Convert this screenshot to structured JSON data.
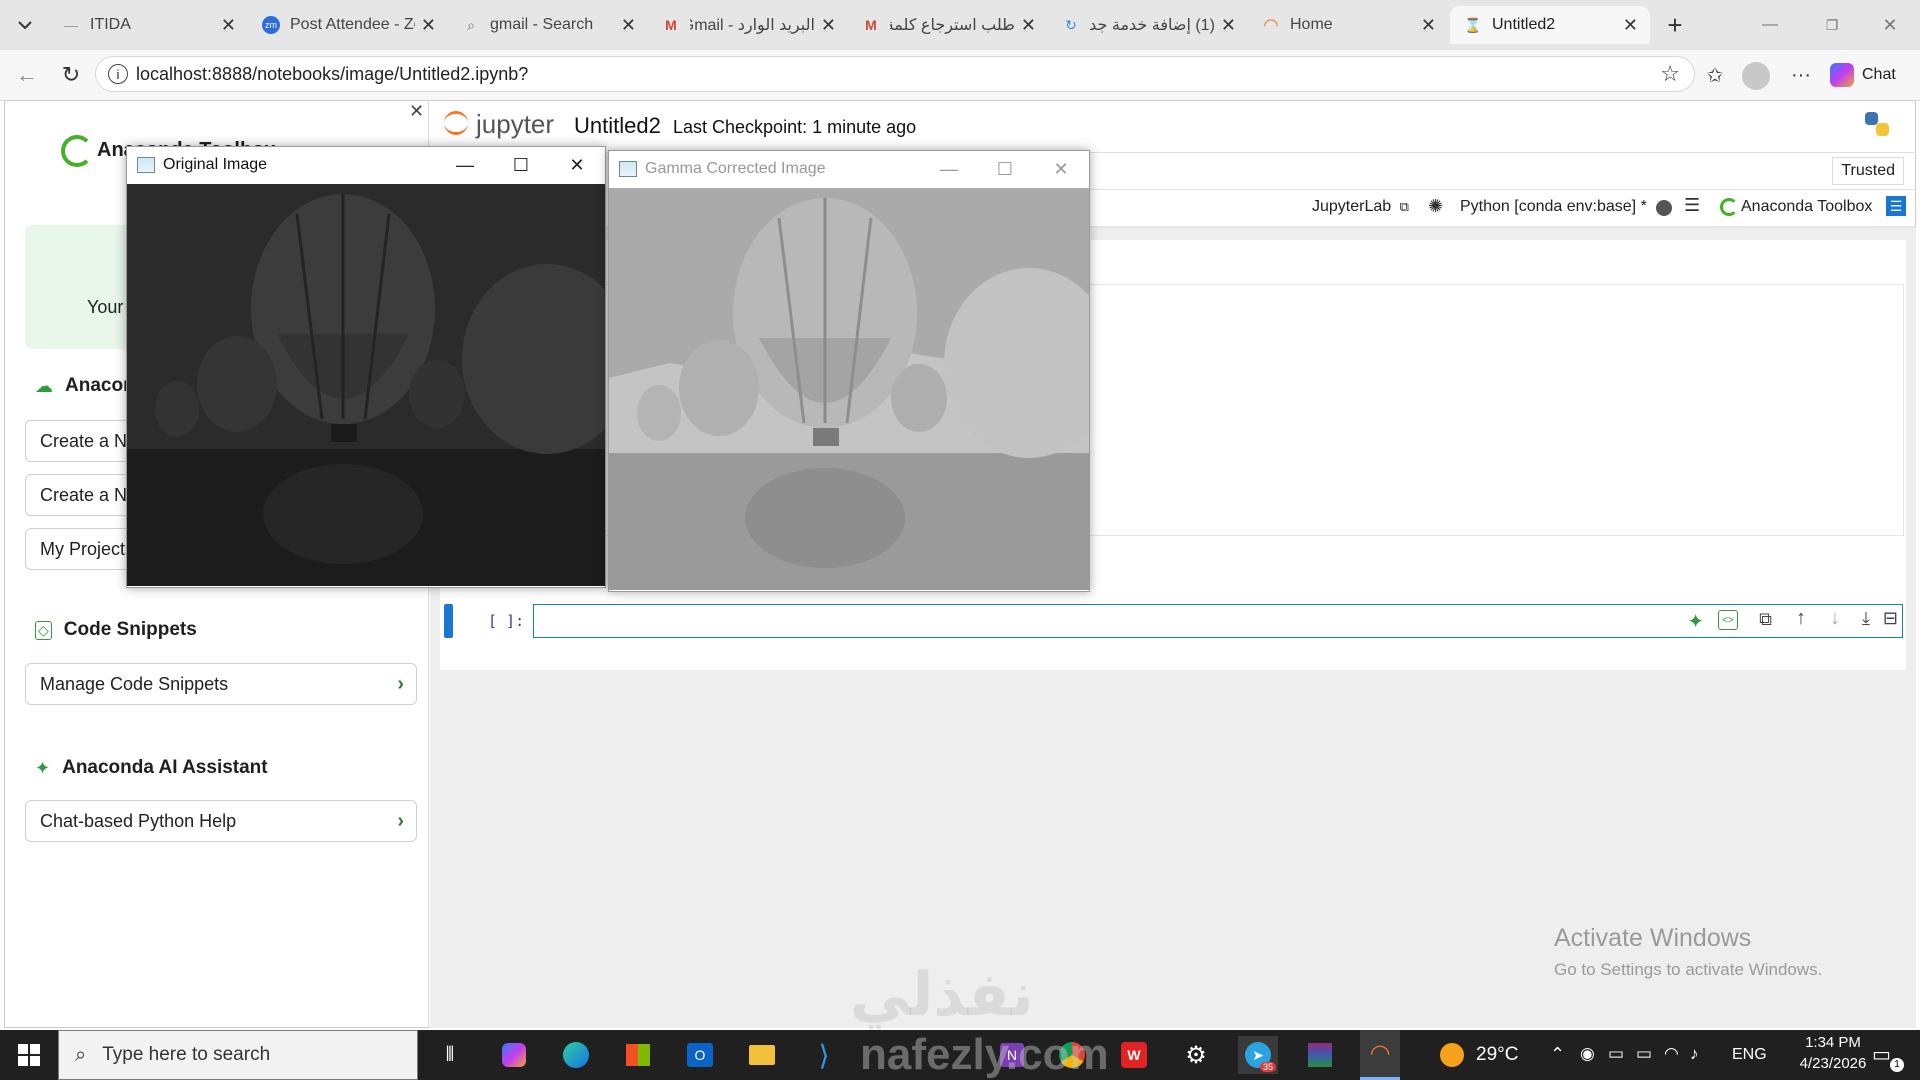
{
  "browser": {
    "tabs": [
      {
        "title": "ITIDA",
        "icon": "itida-icon"
      },
      {
        "title": "Post Attendee - Zo",
        "icon": "zoom-icon"
      },
      {
        "title": "gmail - Search",
        "icon": "search-icon"
      },
      {
        "title": "البريد الوارد - Gmail",
        "icon": "gmail-icon"
      },
      {
        "title": "طلب استرجاع كلمة",
        "icon": "gmail-icon"
      },
      {
        "title": "(1) إضافة خدمة جد",
        "icon": "loading-icon"
      },
      {
        "title": "Home",
        "icon": "jupyter-icon"
      },
      {
        "title": "Untitled2",
        "icon": "hourglass-icon"
      }
    ],
    "url": "localhost:8888/notebooks/image/Untitled2.ipynb?",
    "chat_label": "Chat"
  },
  "sidebar": {
    "panel_title": "Anaconda Toolbox",
    "banner_text": "Your",
    "section_anaconda": "Anaconda",
    "buttons_anaconda": [
      "Create a New",
      "Create a New",
      "My Projects"
    ],
    "section_snippets": "Code Snippets",
    "snippets_button": "Manage Code Snippets",
    "section_ai": "Anaconda AI Assistant",
    "ai_button": "Chat-based Python Help"
  },
  "notebook": {
    "logo_text": "jupyter",
    "name": "Untitled2",
    "checkpoint": "Last Checkpoint: 1 minute ago",
    "trusted": "Trusted",
    "jupyterlab": "JupyterLab",
    "kernel": "Python [conda env:base] *",
    "toolbox": "Anaconda Toolbox",
    "cell_prompt": "[ ]:"
  },
  "windows": {
    "original": "Original Image",
    "gamma": "Gamma Corrected Image"
  },
  "watermark": {
    "activate_title": "Activate Windows",
    "activate_sub": "Go to Settings to activate Windows.",
    "site_arabic": "نفذلي",
    "site": "nafezly.com"
  },
  "taskbar": {
    "search_placeholder": "Type here to search",
    "weather": "29°C",
    "lang": "ENG",
    "time": "1:34 PM",
    "date": "4/23/2026",
    "telegram_badge": "35",
    "notif_count": "1"
  },
  "colors": {
    "accent_blue": "#1976d2",
    "anaconda_green": "#43b02a",
    "jupyter_orange": "#f37726"
  }
}
